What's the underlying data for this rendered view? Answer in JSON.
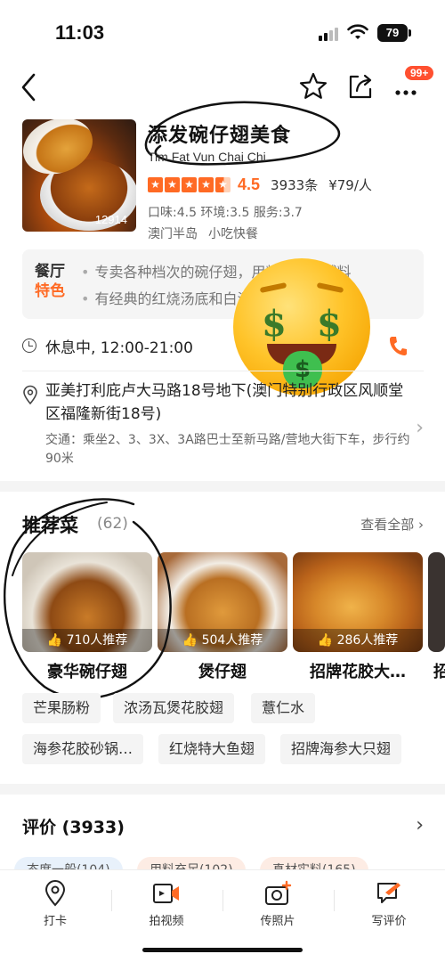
{
  "status": {
    "time": "11:03",
    "battery": "79"
  },
  "nav": {
    "badge": "99+"
  },
  "shop": {
    "name": "添发碗仔翅美食",
    "name_en": "Tim Fat Vun Chai Chi",
    "photo_count": "12914",
    "score": "4.5",
    "review_count": "3933条",
    "price": "¥79/人",
    "sub_scores": "口味:4.5 环境:3.5 服务:3.7",
    "area": "澳门半岛",
    "category": "小吃快餐"
  },
  "feature": {
    "label_1": "餐厅",
    "label_2": "特色",
    "line_1": "专卖各种档次的碗仔翅，用料大小和辅料",
    "line_2": "有经典的红烧汤底和白汤汤底，口感丰富"
  },
  "hours": {
    "text": "休息中, 12:00-21:00"
  },
  "address": {
    "text": "亚美打利庇卢大马路18号地下(澳门特别行政区风顺堂区福隆新街18号)",
    "transit": "交通：乘坐2、3、3X、3A路巴士至新马路/营地大街下车，步行约90米"
  },
  "recommend": {
    "title": "推荐菜",
    "count": "(62)",
    "view_all": "查看全部",
    "dishes": [
      {
        "name": "豪华碗仔翅",
        "badge": "710人推荐"
      },
      {
        "name": "煲仔翅",
        "badge": "504人推荐"
      },
      {
        "name": "招牌花胶大…",
        "badge": "286人推荐"
      },
      {
        "name": "招",
        "badge": ""
      }
    ],
    "tags_row1": [
      "芒果肠粉",
      "浓汤瓦煲花胶翅",
      "薏仁水"
    ],
    "tags_row2": [
      "海参花胶砂锅…",
      "红烧特大鱼翅",
      "招牌海参大只翅"
    ]
  },
  "reviews": {
    "title": "评价",
    "count": "(3933)",
    "chips": [
      "态度一般(104)",
      "用料充足(102)",
      "真材实料(165)"
    ]
  },
  "tabbar": {
    "items": [
      "打卡",
      "拍视频",
      "传照片",
      "写评价"
    ]
  },
  "colors": {
    "accent": "#ff6a24",
    "badge": "#ff5030"
  }
}
